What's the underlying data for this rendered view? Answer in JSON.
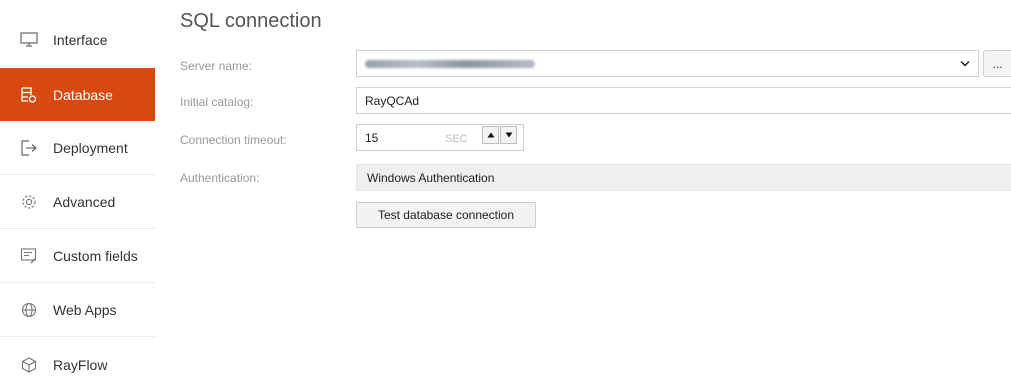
{
  "sidebar": {
    "items": [
      {
        "label": "Interface",
        "icon": "monitor-icon",
        "active": false
      },
      {
        "label": "Database",
        "icon": "database-icon",
        "active": true
      },
      {
        "label": "Deployment",
        "icon": "deployment-icon",
        "active": false
      },
      {
        "label": "Advanced",
        "icon": "gear-icon",
        "active": false
      },
      {
        "label": "Custom fields",
        "icon": "custom-fields-icon",
        "active": false
      },
      {
        "label": "Web Apps",
        "icon": "globe-icon",
        "active": false
      },
      {
        "label": "RayFlow",
        "icon": "cube-icon",
        "active": false
      }
    ],
    "active_color": "#d9480f"
  },
  "main": {
    "title": "SQL connection",
    "server_name": {
      "label": "Server name:",
      "ellipsis": "..."
    },
    "initial_catalog": {
      "label": "Initial catalog:",
      "value": "RayQCAd"
    },
    "connection_timeout": {
      "label": "Connection timeout:",
      "value": "15",
      "unit": "SEC"
    },
    "authentication": {
      "label": "Authentication:",
      "value": "Windows Authentication"
    },
    "test_button": "Test database connection"
  }
}
